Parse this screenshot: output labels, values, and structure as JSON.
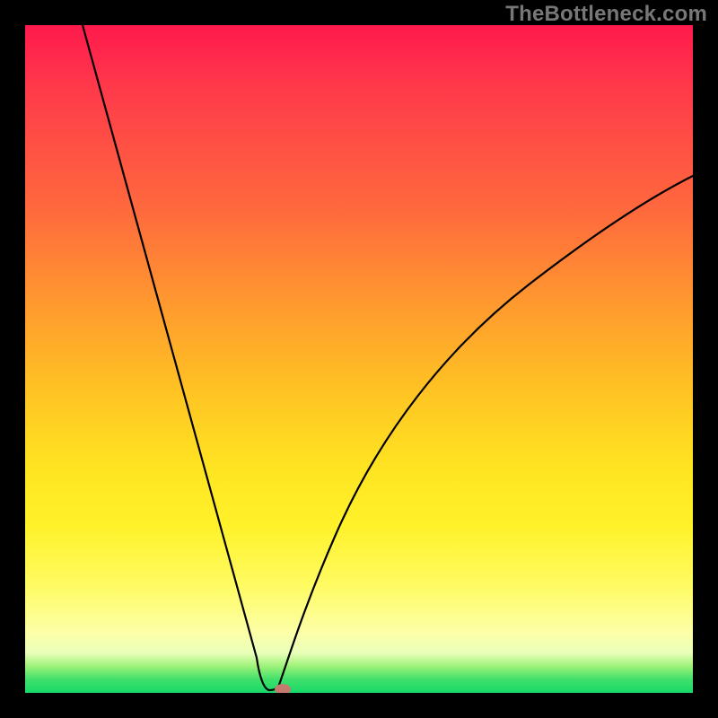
{
  "attribution": "TheBottleneck.com",
  "chart_data": {
    "type": "line",
    "title": "",
    "xlabel": "",
    "ylabel": "",
    "x": [
      0.0,
      0.05,
      0.1,
      0.15,
      0.2,
      0.25,
      0.3,
      0.33,
      0.35,
      0.37,
      0.38,
      0.4,
      0.45,
      0.5,
      0.55,
      0.6,
      0.7,
      0.8,
      0.9,
      1.0
    ],
    "values": [
      1.0,
      0.86,
      0.72,
      0.58,
      0.44,
      0.3,
      0.16,
      0.05,
      0.01,
      0.0,
      0.0,
      0.04,
      0.15,
      0.25,
      0.33,
      0.4,
      0.5,
      0.58,
      0.64,
      0.69
    ],
    "xlim": [
      0,
      1
    ],
    "ylim": [
      0,
      1
    ],
    "minimum": {
      "x": 0.37,
      "y": 0.0
    },
    "marker": {
      "x": 0.385,
      "y": 0.0
    },
    "gradient_colors": {
      "top": "#ff1a4d",
      "mid_upper": "#ff9a2e",
      "mid": "#ffe321",
      "mid_lower": "#fcffa8",
      "bottom": "#18d96a"
    }
  }
}
